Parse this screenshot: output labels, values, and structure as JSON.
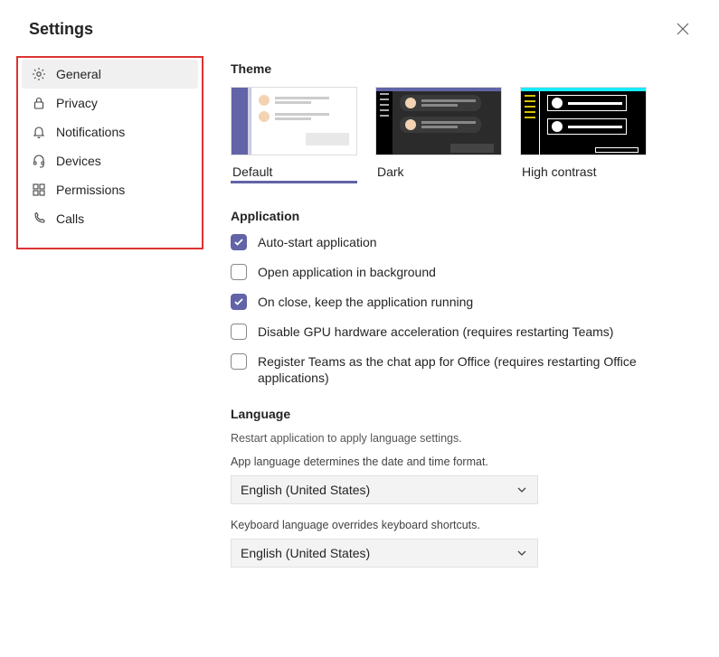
{
  "header": {
    "title": "Settings"
  },
  "sidebar": {
    "items": [
      {
        "label": "General",
        "icon": "gear-icon",
        "active": true
      },
      {
        "label": "Privacy",
        "icon": "lock-icon",
        "active": false
      },
      {
        "label": "Notifications",
        "icon": "bell-icon",
        "active": false
      },
      {
        "label": "Devices",
        "icon": "headset-icon",
        "active": false
      },
      {
        "label": "Permissions",
        "icon": "app-grid-icon",
        "active": false
      },
      {
        "label": "Calls",
        "icon": "phone-icon",
        "active": false
      }
    ]
  },
  "theme": {
    "title": "Theme",
    "options": [
      {
        "label": "Default",
        "selected": true
      },
      {
        "label": "Dark",
        "selected": false
      },
      {
        "label": "High contrast",
        "selected": false
      }
    ]
  },
  "application": {
    "title": "Application",
    "options": [
      {
        "label": "Auto-start application",
        "checked": true
      },
      {
        "label": "Open application in background",
        "checked": false
      },
      {
        "label": "On close, keep the application running",
        "checked": true
      },
      {
        "label": "Disable GPU hardware acceleration (requires restarting Teams)",
        "checked": false
      },
      {
        "label": "Register Teams as the chat app for Office (requires restarting Office applications)",
        "checked": false
      }
    ]
  },
  "language": {
    "title": "Language",
    "helper": "Restart application to apply language settings.",
    "appLangLabel": "App language determines the date and time format.",
    "appLangValue": "English (United States)",
    "kbLangLabel": "Keyboard language overrides keyboard shortcuts.",
    "kbLangValue": "English (United States)"
  },
  "colors": {
    "accent": "#6264a7",
    "highlight": "#d33"
  }
}
